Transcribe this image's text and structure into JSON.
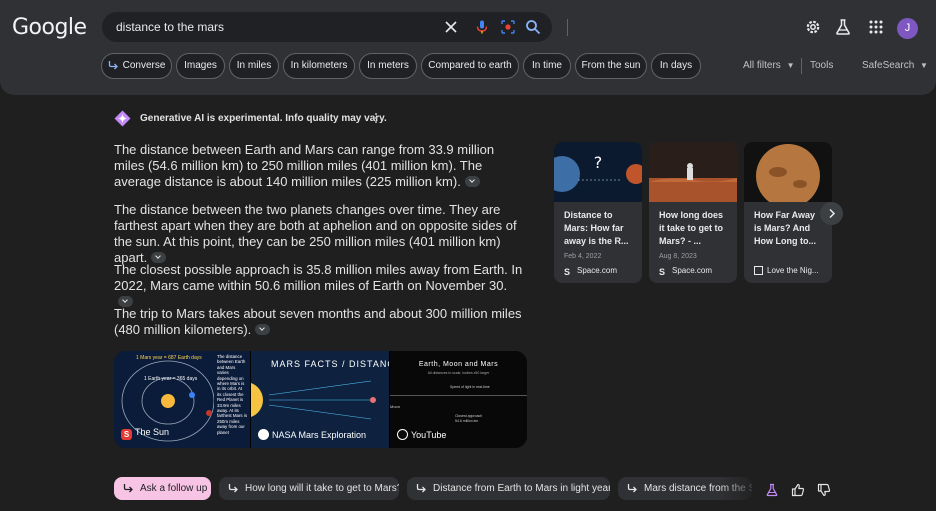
{
  "logo": "Google",
  "search": {
    "query": "distance to the mars"
  },
  "header": {
    "avatar_letter": "J"
  },
  "chips": [
    "Converse",
    "Images",
    "In miles",
    "In kilometers",
    "In meters",
    "Compared to earth",
    "In time",
    "From the sun",
    "In days"
  ],
  "tools": {
    "all_filters": "All filters",
    "tools": "Tools",
    "safesearch": "SafeSearch"
  },
  "ai": {
    "disclaimer": "Generative AI is experimental. Info quality may vary.",
    "paragraphs": [
      "The distance between Earth and Mars can range from 33.9 million miles (54.6 million km) to 250 million miles (401 million km). The average distance is about 140 million miles (225 million km).",
      "The distance between the two planets changes over time. They are farthest apart when they are both at aphelion and on opposite sides of the sun. At this point, they can be 250 million miles (401 million km) apart.",
      "The closest possible approach is 35.8 million miles away from Earth. In 2022, Mars came within 50.6 million miles of Earth on November 30.",
      "The trip to Mars takes about seven months and about 300 million miles (480 million kilometers)."
    ],
    "images": [
      {
        "source": "The Sun",
        "text1": "1 Mars year = 687 Earth days",
        "text2": "1 Earth year = 365 days",
        "side_text": "The distance between Earth and Mars varies depending on where Mars is in its orbit. At its closest the Red Planet is 33.9m miles away. At its farthest Mars is 250m miles away from our planet"
      },
      {
        "source": "NASA Mars Exploration",
        "title": "MARS FACTS / DISTANCE"
      },
      {
        "source": "YouTube",
        "title": "Earth, Moon and Mars",
        "subtitle": "All distances to scale, bodies x50 larger",
        "moon_label": "Moon",
        "speed_note": "Speed of light in real-time",
        "closest_note": "Closest approach",
        "closest_value": "54.6 million km"
      }
    ]
  },
  "cards": [
    {
      "title": "Distance to Mars: How far away is the R...",
      "date": "Feb 4, 2022",
      "source": "Space.com",
      "fav": "S"
    },
    {
      "title": "How long does it take to get to Mars? - ...",
      "date": "Aug 8, 2023",
      "source": "Space.com",
      "fav": "S"
    },
    {
      "title": "How Far Away is Mars? And How Long to...",
      "date": "",
      "source": "Love the Nig...",
      "fav": ""
    }
  ],
  "followups": [
    "Ask a follow up",
    "How long will it take to get to Mars?",
    "Distance from Earth to Mars in light years",
    "Mars distance from the Sun"
  ],
  "colors": {
    "accent_pink": "#f8c4e6",
    "background": "#1f1f1f",
    "header": "#303134"
  }
}
